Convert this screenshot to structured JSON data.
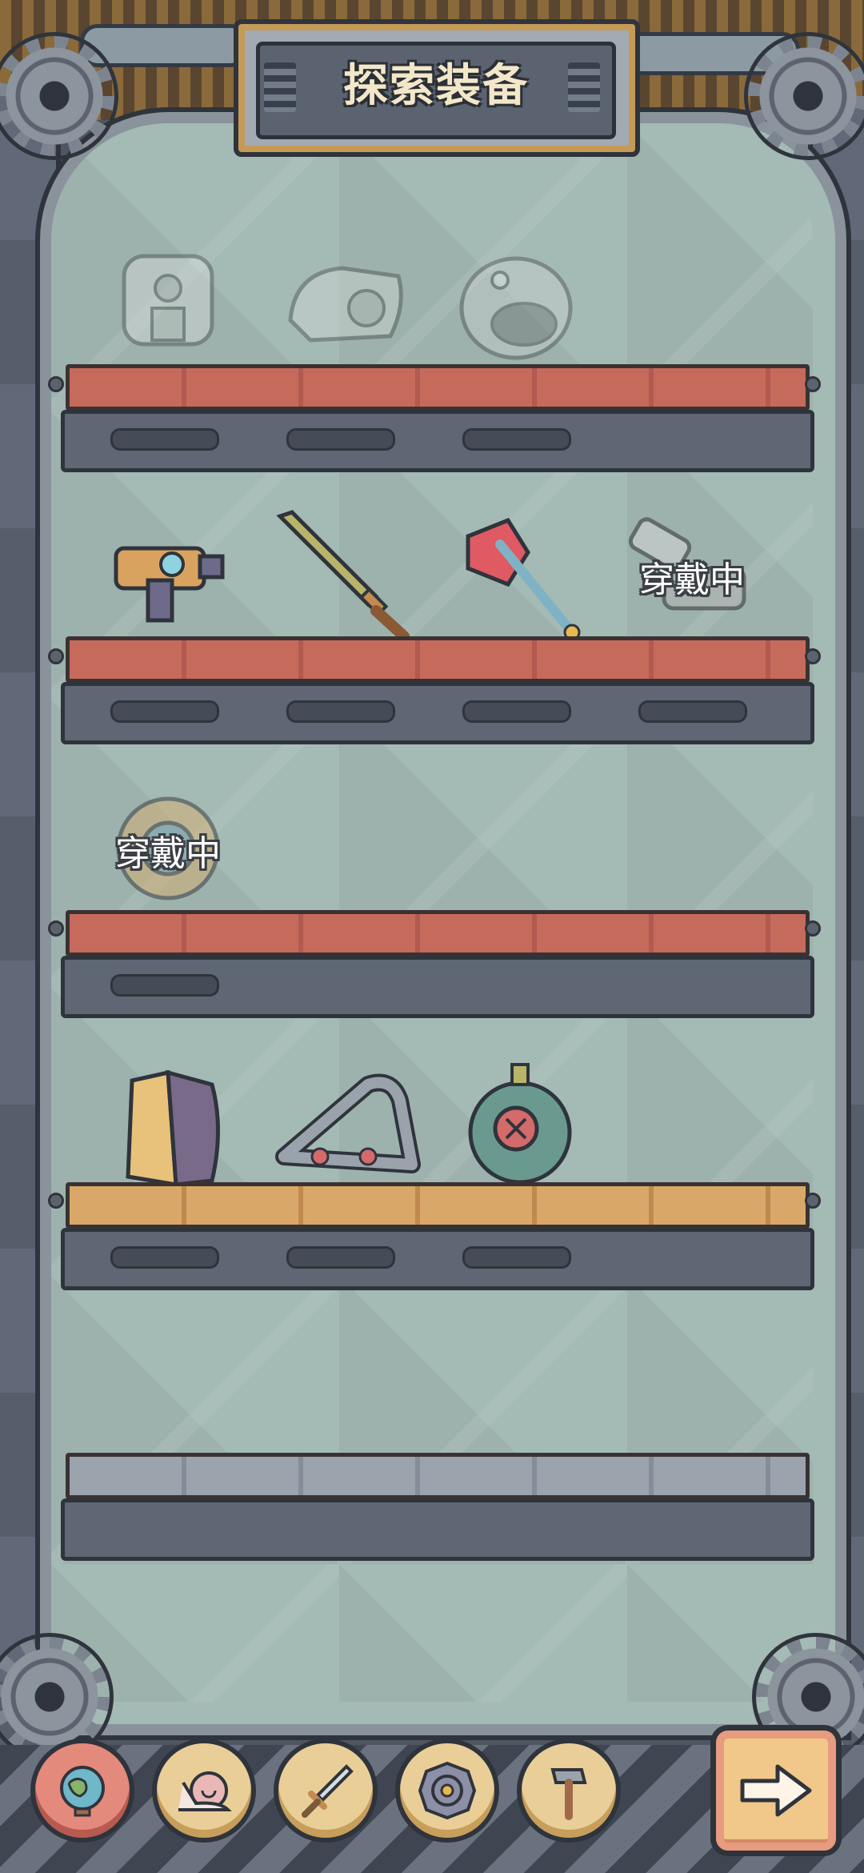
{
  "header": {
    "title": "探索装备"
  },
  "shelves": [
    {
      "id": 1,
      "plank_color": "#c66a5c",
      "items": [
        {
          "name": "chest-armor-locked",
          "status": ""
        },
        {
          "name": "gauntlet-locked",
          "status": ""
        },
        {
          "name": "fish-helmet-locked",
          "status": ""
        }
      ]
    },
    {
      "id": 2,
      "plank_color": "#c66a5c",
      "items": [
        {
          "name": "blaster-gun",
          "status": ""
        },
        {
          "name": "bronze-sword",
          "status": ""
        },
        {
          "name": "crimson-axe",
          "status": ""
        },
        {
          "name": "cannon",
          "status": "穿戴中"
        }
      ]
    },
    {
      "id": 3,
      "plank_color": "#c66a5c",
      "items": [
        {
          "name": "gear-shield",
          "status": "穿戴中"
        }
      ]
    },
    {
      "id": 4,
      "plank_color": "#d9a868",
      "items": [
        {
          "name": "suit-jacket",
          "status": ""
        },
        {
          "name": "tank-tread",
          "status": ""
        },
        {
          "name": "diving-helmet",
          "status": ""
        }
      ]
    },
    {
      "id": 5,
      "plank_color": "#9ba3ad",
      "items": []
    }
  ],
  "bottom_nav": [
    {
      "name": "globe-icon",
      "active": true
    },
    {
      "name": "snail-icon",
      "active": false
    },
    {
      "name": "sword-icon",
      "active": false
    },
    {
      "name": "spiral-shell-icon",
      "active": false
    },
    {
      "name": "hammer-icon",
      "active": false
    }
  ],
  "next_button": {
    "icon": "arrow-right-icon"
  }
}
